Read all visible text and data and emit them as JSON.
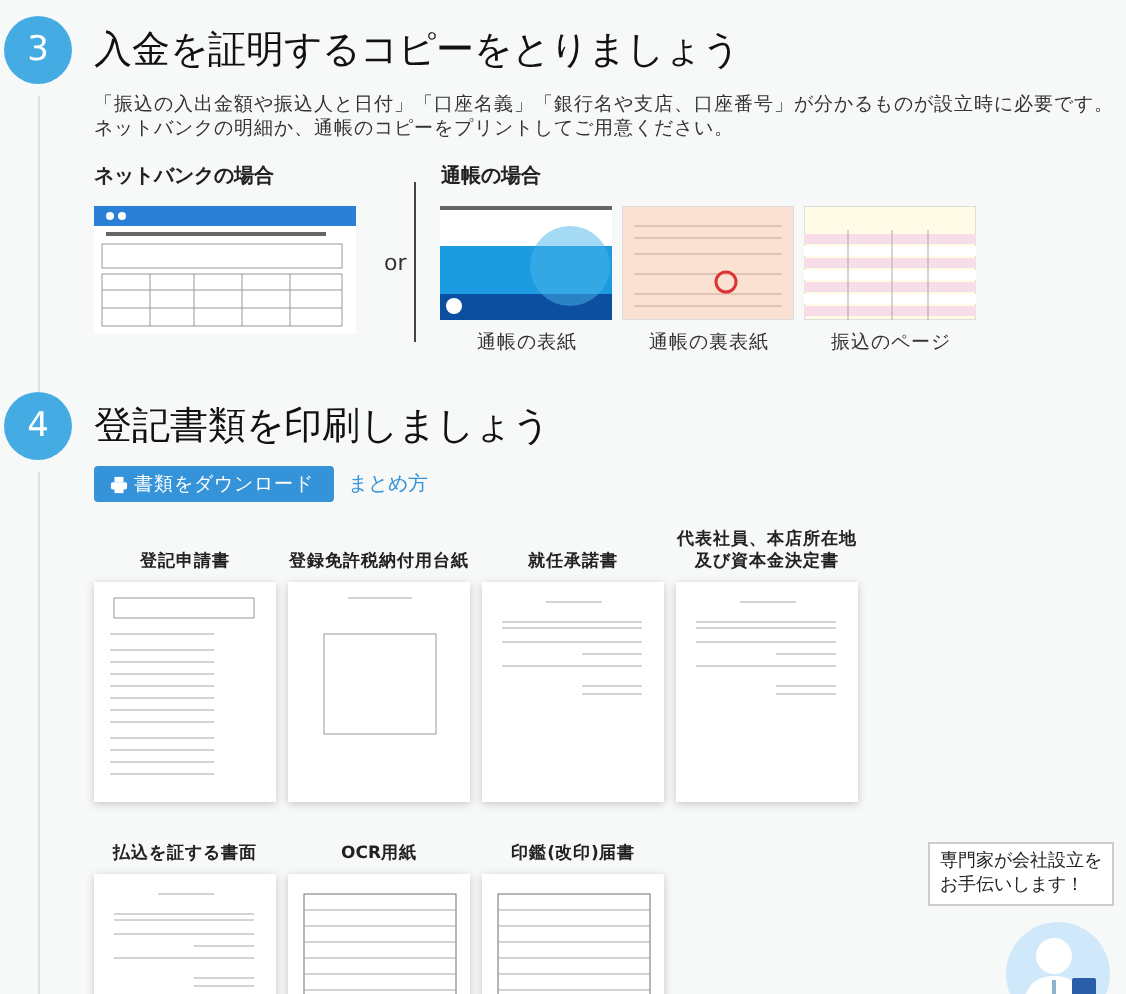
{
  "deposit_step": {
    "number": "3",
    "title": "入金を証明するコピーをとりましょう",
    "description_lines": [
      "「振込の入出金額や振込人と日付」「口座名義」「銀行名や支店、口座番号」が分かるものが設立時に必要です。",
      "ネットバンクの明細か、通帳のコピーをプリントしてご用意ください。"
    ],
    "net_bank_heading": "ネットバンクの場合",
    "or_label": "or",
    "passbook_heading": "通帳の場合",
    "passbook_items": [
      {
        "kind": "cover",
        "caption": "通帳の表紙"
      },
      {
        "kind": "inside_cover",
        "caption": "通帳の裏表紙"
      },
      {
        "kind": "ledger",
        "caption": "振込のページ"
      }
    ]
  },
  "documents_step": {
    "number": "4",
    "title": "登記書類を印刷しましょう",
    "download_button": "書類をダウンロード",
    "guide_link": "まとめ方",
    "documents": [
      {
        "kind": "form",
        "title_lines": [
          "登記申請書"
        ]
      },
      {
        "kind": "mount",
        "title_lines": [
          "登録免許税納付用台紙"
        ]
      },
      {
        "kind": "letter",
        "title_lines": [
          "就任承諾書"
        ]
      },
      {
        "kind": "letter",
        "title_lines": [
          "代表社員、本店所在地",
          "及び資本金決定書"
        ]
      },
      {
        "kind": "letter",
        "title_lines": [
          "払込を証する書面"
        ]
      },
      {
        "kind": "table",
        "title_lines": [
          "OCR用紙"
        ]
      },
      {
        "kind": "table",
        "title_lines": [
          "印鑑(改印)届書"
        ]
      }
    ]
  },
  "help_widget": {
    "message_lines": [
      "専門家が会社設立を",
      "お手伝いします！"
    ]
  }
}
